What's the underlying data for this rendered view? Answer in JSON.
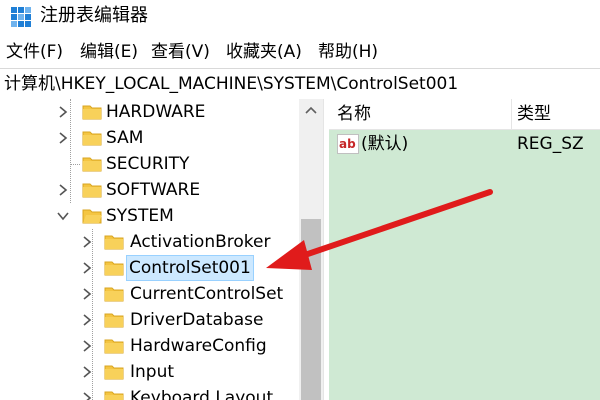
{
  "window": {
    "title": "注册表编辑器"
  },
  "menu": {
    "file": "文件(F)",
    "edit": "编辑(E)",
    "view": "查看(V)",
    "favorites": "收藏夹(A)",
    "help": "帮助(H)"
  },
  "address": {
    "path": "计算机\\HKEY_LOCAL_MACHINE\\SYSTEM\\ControlSet001"
  },
  "tree": {
    "items": [
      {
        "label": "HARDWARE"
      },
      {
        "label": "SAM"
      },
      {
        "label": "SECURITY"
      },
      {
        "label": "SOFTWARE"
      },
      {
        "label": "SYSTEM"
      },
      {
        "label": "ActivationBroker"
      },
      {
        "label": "ControlSet001"
      },
      {
        "label": "CurrentControlSet"
      },
      {
        "label": "DriverDatabase"
      },
      {
        "label": "HardwareConfig"
      },
      {
        "label": "Input"
      },
      {
        "label": "Keyboard Layout"
      }
    ],
    "selected": "ControlSet001"
  },
  "values": {
    "columns": {
      "name": "名称",
      "type": "类型"
    },
    "rows": [
      {
        "name": "(默认)",
        "type": "REG_SZ"
      }
    ]
  },
  "colors": {
    "values_bg": "#cfe9d3",
    "selection_bg": "#cce8ff",
    "folder": "#f4c542",
    "arrow": "#e01b1b",
    "app_icon": "#1f7fd6"
  },
  "icons": {
    "app": "registry-editor-icon",
    "folder": "folder-icon",
    "chevron_right": "chevron-right-icon",
    "chevron_down": "chevron-down-icon",
    "string_value": "ab-string-value-icon"
  }
}
